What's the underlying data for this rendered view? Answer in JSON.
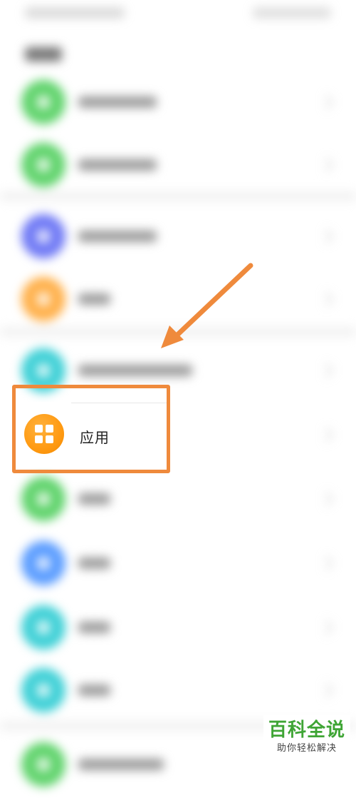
{
  "highlighted_item": {
    "label": "应用",
    "icon": "apps-grid-icon",
    "icon_color": "#ff9a12"
  },
  "annotation": {
    "frame_color": "#ef8a3c",
    "arrow_color": "#ef8a3c"
  },
  "background_rows": [
    {
      "icon_color": "#5fd36b"
    },
    {
      "icon_color": "#5fd36b"
    },
    {
      "icon_color": "#6f79f5"
    },
    {
      "icon_color": "#ffb04a"
    },
    {
      "icon_color": "#3ed0d6"
    },
    {
      "icon_color": "#5fd36b"
    },
    {
      "icon_color": "#5a9cff"
    },
    {
      "icon_color": "#3ed0d6"
    },
    {
      "icon_color": "#3ed0d6"
    },
    {
      "icon_color": "#5fd36b"
    }
  ],
  "watermark": {
    "title": "百科全说",
    "subtitle": "助你轻松解决",
    "title_color": "#3fa535"
  }
}
